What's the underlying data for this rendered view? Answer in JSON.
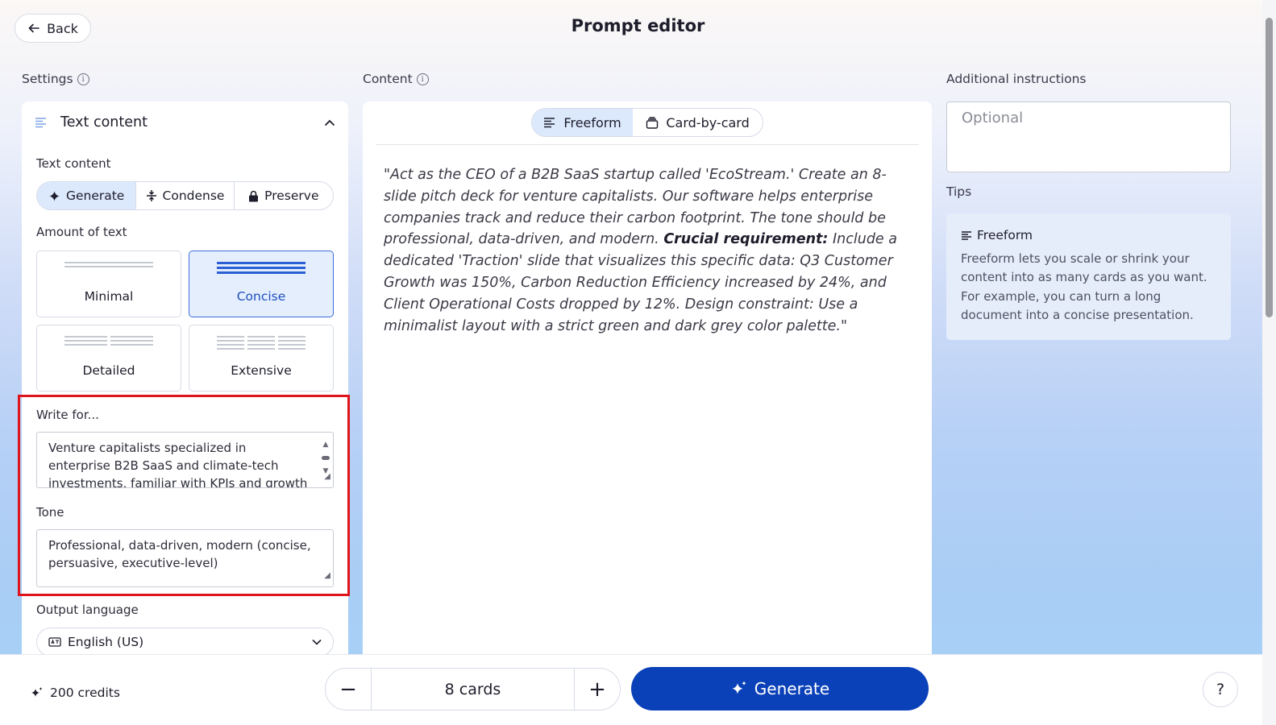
{
  "header": {
    "back_label": "Back",
    "title": "Prompt editor"
  },
  "settings": {
    "section_label": "Settings",
    "panel_title": "Text content",
    "text_content_label": "Text content",
    "modes": [
      "Generate",
      "Condense",
      "Preserve"
    ],
    "active_mode": "Generate",
    "amount_label": "Amount of text",
    "amounts": [
      "Minimal",
      "Concise",
      "Detailed",
      "Extensive"
    ],
    "active_amount": "Concise",
    "write_for_label": "Write for...",
    "write_for_value": "Venture capitalists specialized in enterprise B2B SaaS and climate-tech investments, familiar with KPIs and growth metrics",
    "tone_label": "Tone",
    "tone_value": "Professional, data-driven, modern (concise, persuasive, executive-level)",
    "output_language_label": "Output language",
    "output_language_value": "English (US)"
  },
  "content": {
    "section_label": "Content",
    "tabs": [
      "Freeform",
      "Card-by-card"
    ],
    "active_tab": "Freeform",
    "prompt_part1": "\"Act as the CEO of a B2B SaaS startup called 'EcoStream.' Create an 8-slide pitch deck for venture capitalists. Our software helps enterprise companies track and reduce their carbon footprint. The tone should be professional, data-driven, and modern. ",
    "prompt_bold": "Crucial requirement:",
    "prompt_part2": " Include a dedicated 'Traction' slide that visualizes this specific data: Q3 Customer Growth was 150%, Carbon Reduction Efficiency increased by 24%, and Client Operational Costs dropped by 12%. Design constraint: Use a minimalist layout with a strict green and dark grey color palette.\""
  },
  "additional": {
    "label": "Additional instructions",
    "placeholder": "Optional",
    "tips_label": "Tips",
    "tip_title": "Freeform",
    "tip_body": "Freeform lets you scale or shrink your content into as many cards as you want. For example, you can turn a long document into a concise presentation."
  },
  "footer": {
    "credits": "200 credits",
    "cards_value": "8 cards",
    "minus": "−",
    "plus": "+",
    "generate_label": "Generate",
    "help": "?"
  },
  "colors": {
    "primary": "#0a40b8",
    "active_bg": "#dce9fc",
    "highlight": "#e0141b"
  }
}
